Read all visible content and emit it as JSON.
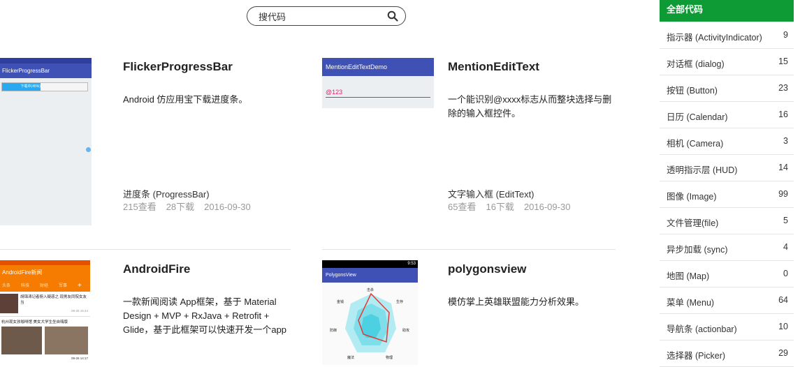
{
  "search": {
    "placeholder": "搜代码"
  },
  "projects": [
    {
      "title": "FlickerProgressBar",
      "description": "Android 仿应用宝下载进度条。",
      "category": "进度条 (ProgressBar)",
      "views": "215查看",
      "downloads": "28下载",
      "date": "2016-09-30",
      "thumb": {
        "app_title": "FlickerProgressBar",
        "button_text": "下载中(45%)"
      }
    },
    {
      "title": "MentionEditText",
      "description": "一个能识别@xxxx标志从而整块选择与删除的输入框控件。",
      "category": "文字输入框 (EditText)",
      "views": "65查看",
      "downloads": "16下载",
      "date": "2016-09-30",
      "thumb": {
        "app_title": "MentionEditTextDemo",
        "input_text": "@123"
      }
    },
    {
      "title": "AndroidFire",
      "description": "一款新闻阅读 App框架，基于 Material Design + MVP + RxJava + Retrofit + Glide，基于此框架可以快速开发一个app",
      "thumb": {
        "app_title": "AndroidFire新闻",
        "tabs": [
          "头条",
          "科技",
          "财经",
          "军事"
        ],
        "headline1": "胡锦涛记者俯入疑惑之 现男友同院女友当",
        "headline2": "杭州现女孩咖啡馆 美女大学生坐自嗨版",
        "time1": "09-26 15:44",
        "time2": "09-26 14:17"
      }
    },
    {
      "title": "polygonsview",
      "description": "模仿掌上英雄联盟能力分析效果。",
      "thumb": {
        "app_title": "PolygonsView",
        "status_time": "9:53",
        "labels": [
          "击杀",
          "生存",
          "助攻",
          "物理",
          "魔法",
          "防御",
          "金钱"
        ]
      }
    }
  ],
  "sidebar": {
    "header": "全部代码",
    "items": [
      {
        "label": "指示器 (ActivityIndicator)",
        "count": "9"
      },
      {
        "label": "对话框 (dialog)",
        "count": "15"
      },
      {
        "label": "按钮 (Button)",
        "count": "23"
      },
      {
        "label": "日历 (Calendar)",
        "count": "16"
      },
      {
        "label": "相机 (Camera)",
        "count": "3"
      },
      {
        "label": "透明指示层 (HUD)",
        "count": "14"
      },
      {
        "label": "图像 (Image)",
        "count": "99"
      },
      {
        "label": "文件管理(file)",
        "count": "5"
      },
      {
        "label": "异步加载 (sync)",
        "count": "4"
      },
      {
        "label": "地图 (Map)",
        "count": "0"
      },
      {
        "label": "菜单 (Menu)",
        "count": "64"
      },
      {
        "label": "导航条 (actionbar)",
        "count": "10"
      },
      {
        "label": "选择器 (Picker)",
        "count": "29"
      }
    ]
  },
  "colors": {
    "accent": "#0e9a35",
    "app_bar_blue": "#3f51b5",
    "app_bar_orange": "#f57c00",
    "divider": "#e2e2e2"
  }
}
